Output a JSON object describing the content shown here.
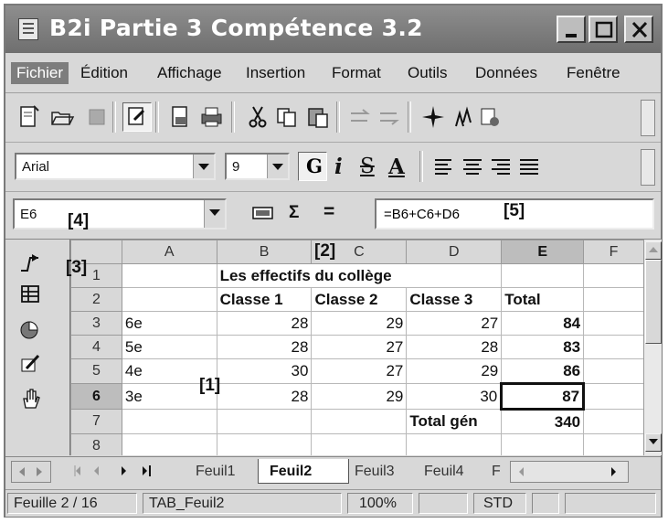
{
  "window": {
    "title": "B2i Partie 3 Compétence 3.2"
  },
  "menu": [
    "Fichier",
    "Édition",
    "Affichage",
    "Insertion",
    "Format",
    "Outils",
    "Données",
    "Fenêtre"
  ],
  "font": {
    "name": "Arial",
    "size": "9",
    "bold_label": "G",
    "italic_label": "i",
    "strike_label": "S",
    "color_label": "A"
  },
  "formula_bar": {
    "cell_ref": "E6",
    "sum_symbol": "Σ",
    "equals_symbol": "=",
    "formula": "=B6+C6+D6"
  },
  "callouts": {
    "c1": "[1]",
    "c2": "[2]",
    "c3": "[3]",
    "c4": "[4]",
    "c5": "[5]"
  },
  "sheet": {
    "columns": [
      "A",
      "B",
      "C",
      "D",
      "E",
      "F"
    ],
    "selected_column": "E",
    "selected_row": "6",
    "rows": [
      {
        "num": "1",
        "cells": [
          "",
          "Les effectifs du collège",
          "",
          "",
          "",
          ""
        ]
      },
      {
        "num": "2",
        "cells": [
          "",
          "Classe 1",
          "Classe 2",
          "Classe 3",
          "Total",
          ""
        ]
      },
      {
        "num": "3",
        "cells": [
          "6e",
          "28",
          "29",
          "27",
          "84",
          ""
        ]
      },
      {
        "num": "4",
        "cells": [
          "5e",
          "28",
          "27",
          "28",
          "83",
          ""
        ]
      },
      {
        "num": "5",
        "cells": [
          "4e",
          "30",
          "27",
          "29",
          "86",
          ""
        ]
      },
      {
        "num": "6",
        "cells": [
          "3e",
          "28",
          "29",
          "30",
          "87",
          ""
        ]
      },
      {
        "num": "7",
        "cells": [
          "",
          "",
          "",
          "Total gén",
          "340",
          ""
        ]
      },
      {
        "num": "8",
        "cells": [
          "",
          "",
          "",
          "",
          "",
          ""
        ]
      }
    ]
  },
  "tabs": [
    "Feuil1",
    "Feuil2",
    "Feuil3",
    "Feuil4",
    "F"
  ],
  "active_tab": "Feuil2",
  "status": {
    "sheet": "Feuille 2 / 16",
    "name": "TAB_Feuil2",
    "zoom": "100%",
    "mode": "STD"
  }
}
